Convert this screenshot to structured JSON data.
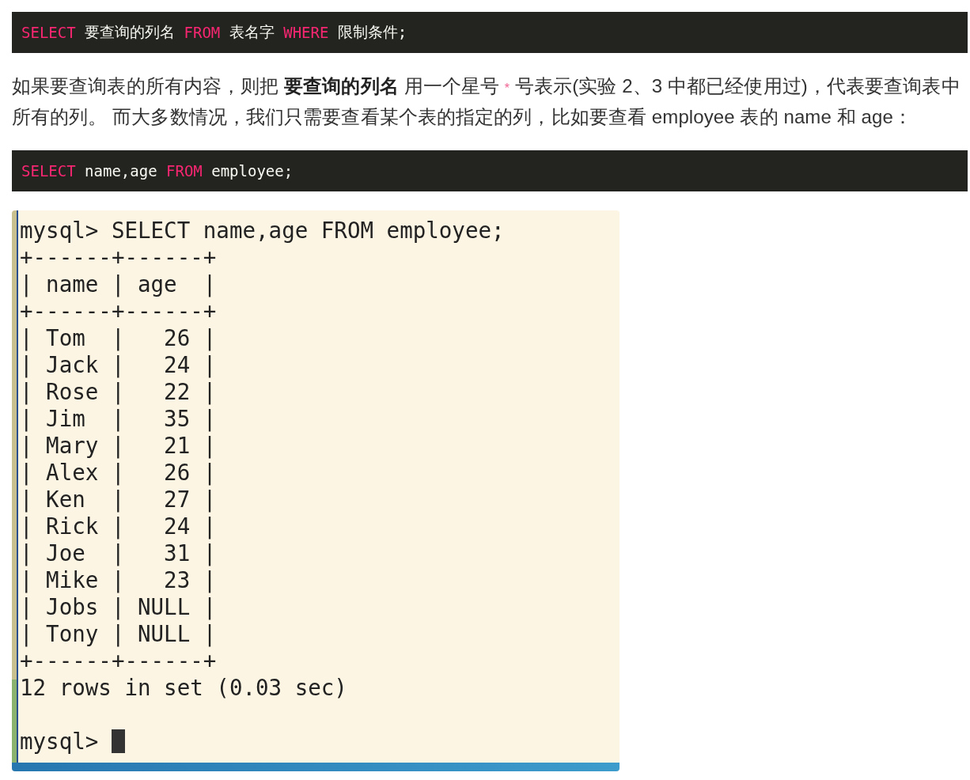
{
  "code_blocks_top": [
    {
      "tokens": [
        {
          "kind": "keyword",
          "text": "SELECT"
        },
        {
          "kind": "text",
          "text": " 要查询的列名 "
        },
        {
          "kind": "keyword",
          "text": "FROM"
        },
        {
          "kind": "text",
          "text": " 表名字 "
        },
        {
          "kind": "keyword",
          "text": "WHERE"
        },
        {
          "kind": "text",
          "text": " 限制条件;"
        }
      ]
    }
  ],
  "paragraph": [
    {
      "kind": "plain",
      "text": "如果要查询表的所有内容，则把 "
    },
    {
      "kind": "bold",
      "text": "要查询的列名"
    },
    {
      "kind": "plain",
      "text": " 用一个星号 "
    },
    {
      "kind": "code",
      "text": "*"
    },
    {
      "kind": "plain",
      "text": " 号表示(实验 2、3 中都已经使用过)，代表要查询表中所有的列。 而大多数情况，我们只需要查看某个表的指定的列，比如要查看 employee 表的 name 和 age："
    }
  ],
  "code_blocks_bottom": [
    {
      "tokens": [
        {
          "kind": "keyword",
          "text": "SELECT"
        },
        {
          "kind": "text",
          "text": " name,age "
        },
        {
          "kind": "keyword",
          "text": "FROM"
        },
        {
          "kind": "text",
          "text": " employee;"
        }
      ]
    }
  ],
  "terminal": {
    "lines": [
      "mysql> SELECT name,age FROM employee;",
      "+------+------+",
      "| name | age  |",
      "+------+------+",
      "| Tom  |   26 |",
      "| Jack |   24 |",
      "| Rose |   22 |",
      "| Jim  |   35 |",
      "| Mary |   21 |",
      "| Alex |   26 |",
      "| Ken  |   27 |",
      "| Rick |   24 |",
      "| Joe  |   31 |",
      "| Mike |   23 |",
      "| Jobs | NULL |",
      "| Tony | NULL |",
      "+------+------+",
      "12 rows in set (0.03 sec)"
    ],
    "prompt": "mysql>"
  }
}
